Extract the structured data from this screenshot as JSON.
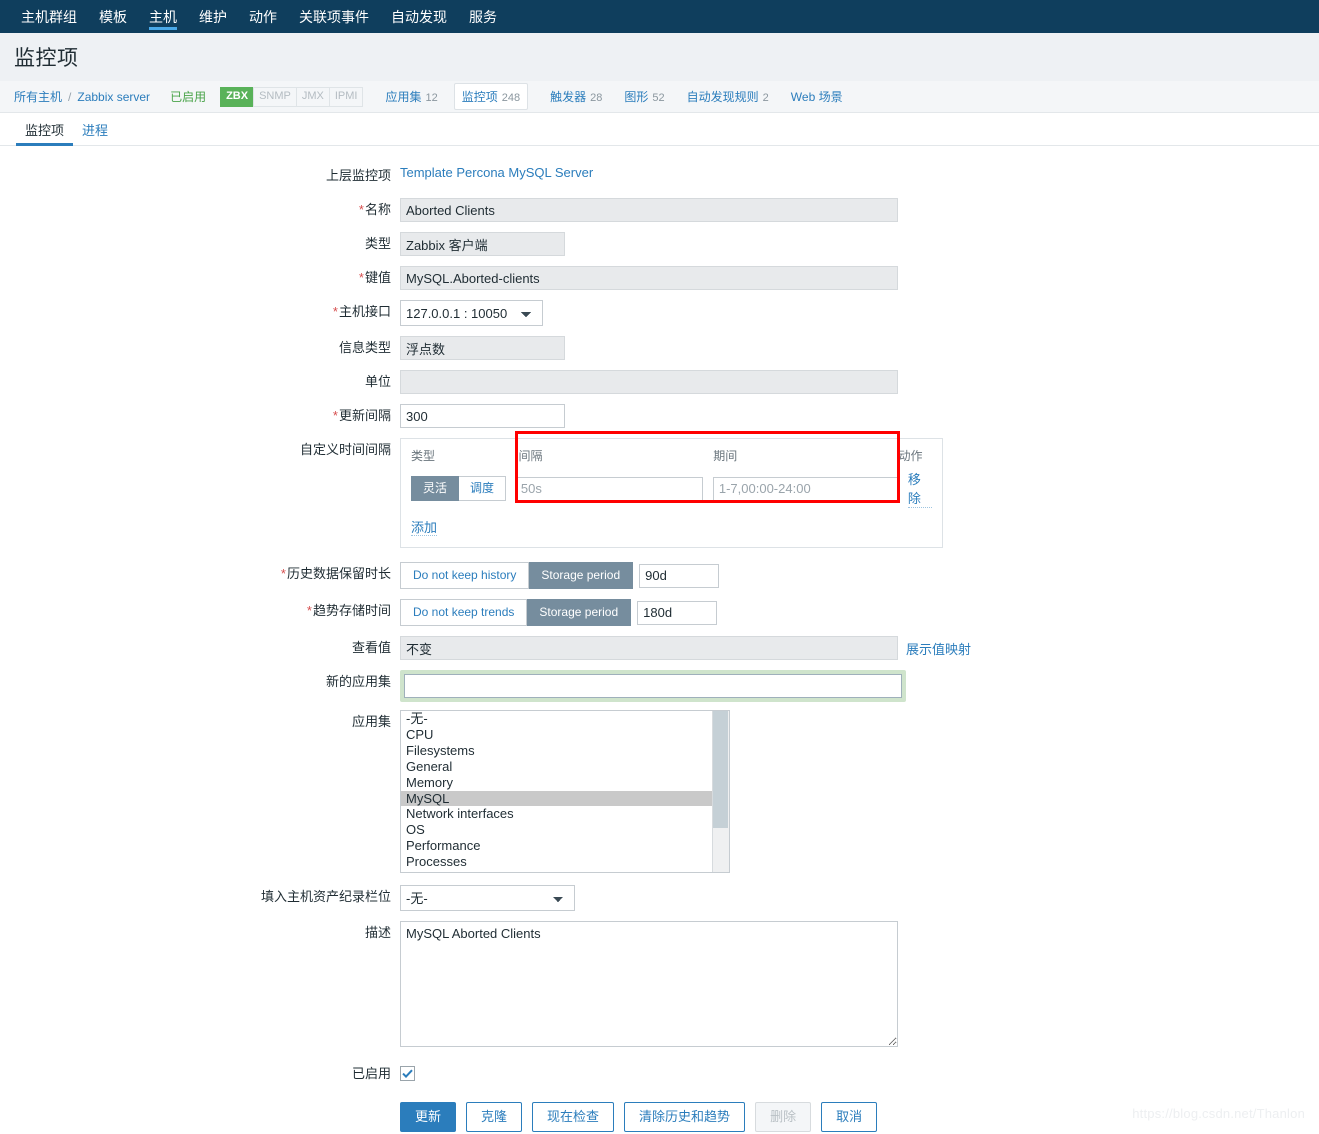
{
  "topnav": {
    "items": [
      {
        "label": "主机群组",
        "active": false
      },
      {
        "label": "模板",
        "active": false
      },
      {
        "label": "主机",
        "active": true
      },
      {
        "label": "维护",
        "active": false
      },
      {
        "label": "动作",
        "active": false
      },
      {
        "label": "关联项事件",
        "active": false
      },
      {
        "label": "自动发现",
        "active": false
      },
      {
        "label": "服务",
        "active": false
      }
    ]
  },
  "header": {
    "title": "监控项"
  },
  "breadcrumb": {
    "all_hosts": "所有主机",
    "separator": "/",
    "host": "Zabbix server",
    "status": "已启用",
    "badges": [
      {
        "label": "ZBX",
        "active": true
      },
      {
        "label": "SNMP",
        "active": false
      },
      {
        "label": "JMX",
        "active": false
      },
      {
        "label": "IPMI",
        "active": false
      }
    ],
    "tabs": [
      {
        "label": "应用集",
        "count": "12",
        "selected": false
      },
      {
        "label": "监控项",
        "count": "248",
        "selected": true
      },
      {
        "label": "触发器",
        "count": "28",
        "selected": false
      },
      {
        "label": "图形",
        "count": "52",
        "selected": false
      },
      {
        "label": "自动发现规则",
        "count": "2",
        "selected": false
      },
      {
        "label": "Web 场景",
        "count": "",
        "selected": false
      }
    ]
  },
  "subtabs": [
    {
      "label": "监控项",
      "active": true
    },
    {
      "label": "进程",
      "active": false
    }
  ],
  "form": {
    "parent_item": {
      "label": "上层监控项",
      "value": "Template Percona MySQL Server"
    },
    "name": {
      "label": "名称",
      "required": true,
      "value": "Aborted Clients"
    },
    "type": {
      "label": "类型",
      "required": false,
      "value": "Zabbix 客户端"
    },
    "key": {
      "label": "键值",
      "required": true,
      "value": "MySQL.Aborted-clients"
    },
    "host_interface": {
      "label": "主机接口",
      "required": true,
      "value": "127.0.0.1 : 10050"
    },
    "value_type": {
      "label": "信息类型",
      "required": false,
      "value": "浮点数"
    },
    "units": {
      "label": "单位",
      "required": false,
      "value": ""
    },
    "update_interval": {
      "label": "更新间隔",
      "required": true,
      "value": "300"
    },
    "custom_intervals": {
      "label": "自定义时间间隔",
      "columns": {
        "type": "类型",
        "interval": "间隔",
        "period": "期间",
        "action": "动作"
      },
      "toggle": [
        {
          "label": "灵活",
          "active": true
        },
        {
          "label": "调度",
          "active": false
        }
      ],
      "interval_placeholder": "50s",
      "interval_value": "",
      "period_placeholder": "1-7,00:00-24:00",
      "period_value": "",
      "remove_label": "移除",
      "add_label": "添加",
      "highlight_color": "#ff0000"
    },
    "history": {
      "label": "历史数据保留时长",
      "required": true,
      "options": [
        {
          "label": "Do not keep history",
          "active": false
        },
        {
          "label": "Storage period",
          "active": true
        }
      ],
      "value": "90d"
    },
    "trends": {
      "label": "趋势存储时间",
      "required": true,
      "options": [
        {
          "label": "Do not keep trends",
          "active": false
        },
        {
          "label": "Storage period",
          "active": true
        }
      ],
      "value": "180d"
    },
    "value_map": {
      "label": "查看值",
      "value": "不变",
      "link_label": "展示值映射"
    },
    "new_application": {
      "label": "新的应用集",
      "value": "",
      "focused": true
    },
    "applications": {
      "label": "应用集",
      "options": [
        {
          "label": "-无-",
          "selected": false
        },
        {
          "label": "CPU",
          "selected": false
        },
        {
          "label": "Filesystems",
          "selected": false
        },
        {
          "label": "General",
          "selected": false
        },
        {
          "label": "Memory",
          "selected": false
        },
        {
          "label": "MySQL",
          "selected": true
        },
        {
          "label": "Network interfaces",
          "selected": false
        },
        {
          "label": "OS",
          "selected": false
        },
        {
          "label": "Performance",
          "selected": false
        },
        {
          "label": "Processes",
          "selected": false
        }
      ]
    },
    "inventory_field": {
      "label": "填入主机资产纪录栏位",
      "value": "-无-"
    },
    "description": {
      "label": "描述",
      "value": "MySQL Aborted Clients"
    },
    "enabled": {
      "label": "已启用",
      "checked": true
    }
  },
  "buttons": [
    {
      "label": "更新",
      "style": "primary"
    },
    {
      "label": "克隆",
      "style": "default"
    },
    {
      "label": "现在检查",
      "style": "default"
    },
    {
      "label": "清除历史和趋势",
      "style": "default"
    },
    {
      "label": "删除",
      "style": "disabled"
    },
    {
      "label": "取消",
      "style": "default"
    }
  ],
  "watermark": "https://blog.csdn.net/Thanlon"
}
